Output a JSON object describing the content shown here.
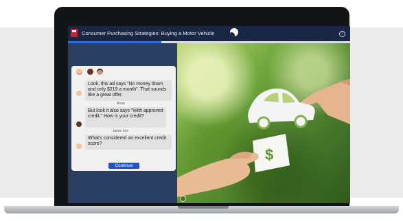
{
  "app": {
    "title": "Consumer Purchasing Strategies: Buying a Motor Vehicle",
    "help_label": "?",
    "progress_fraction": 0.33
  },
  "chat": {
    "messages": [
      {
        "speaker": "",
        "text": "Look, this ad says \"No money down and only $219 a month\". That sounds like a great offer."
      },
      {
        "speaker": "Anna",
        "text": "But look it also says \"With approved credit.\" How is your credit?"
      },
      {
        "speaker": "Jamie Lee",
        "text": "What's considered an excellent credit score?"
      }
    ],
    "continue_label": "Continue"
  },
  "illustration": {
    "dollar_symbol": "$"
  },
  "colors": {
    "accent": "#1d56c7",
    "topbar": "#1a2744",
    "panel": "#2a3d63",
    "logo": "#c8202f"
  }
}
